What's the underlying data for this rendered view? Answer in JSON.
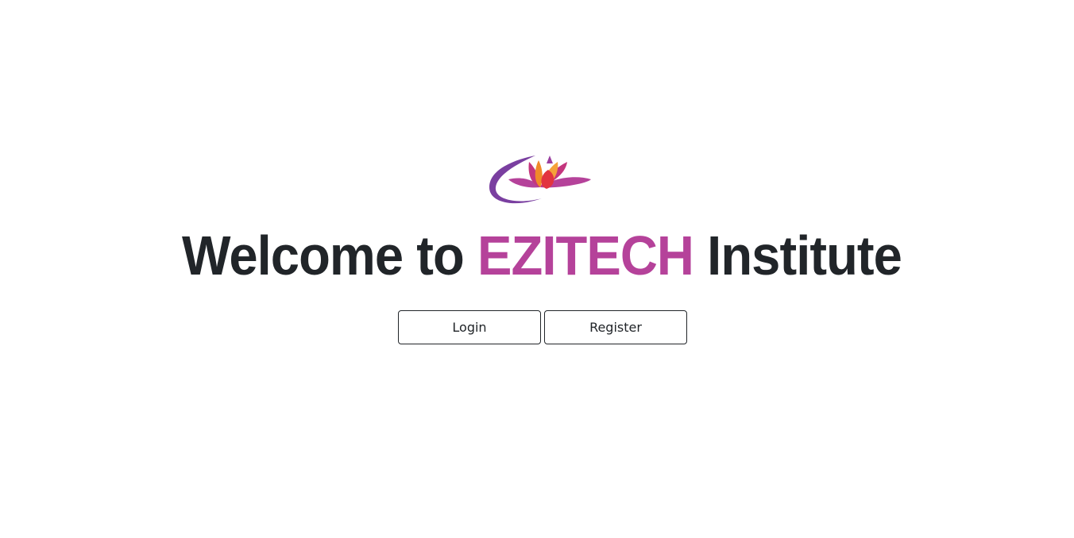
{
  "logo": {
    "icon": "lotus-icon",
    "colors": {
      "petal_outer": "#b5429a",
      "petal_mid": "#e84a7f",
      "petal_inner": "#f08a2a",
      "swirl": "#7a3fa0"
    }
  },
  "heading": {
    "prefix": "Welcome to",
    "brand": "EZITECH",
    "suffix": "Institute"
  },
  "actions": {
    "login_label": "Login",
    "register_label": "Register"
  },
  "colors": {
    "brand": "#b5429a",
    "text": "#212529",
    "background": "#ffffff"
  }
}
